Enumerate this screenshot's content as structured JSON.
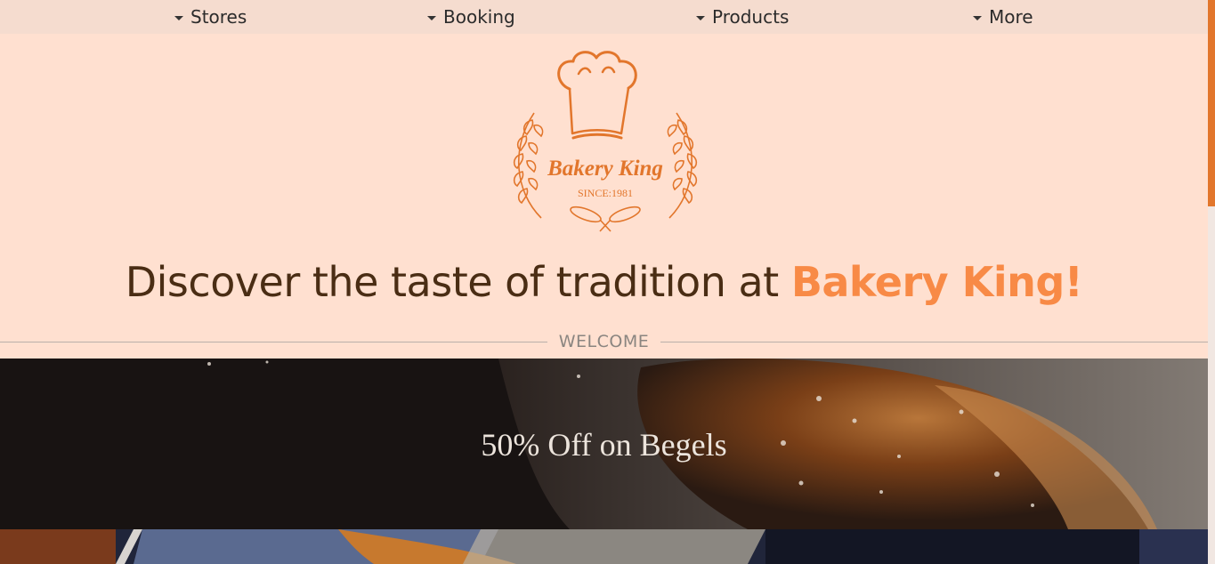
{
  "nav": {
    "items": [
      {
        "label": "Stores"
      },
      {
        "label": "Booking"
      },
      {
        "label": "Products"
      },
      {
        "label": "More"
      }
    ]
  },
  "logo": {
    "name": "Bakery King",
    "since": "SINCE:1981",
    "color": "#e2762c"
  },
  "hero": {
    "headline_main": "Discover the taste of tradition at ",
    "headline_accent": "Bakery King!"
  },
  "section": {
    "label": "WELCOME"
  },
  "banner": {
    "title": "50% Off on Begels"
  },
  "colors": {
    "background": "#ffe0d0",
    "nav_bg": "#f5dccf",
    "headline": "#4a2d14",
    "accent": "#f88a46"
  }
}
